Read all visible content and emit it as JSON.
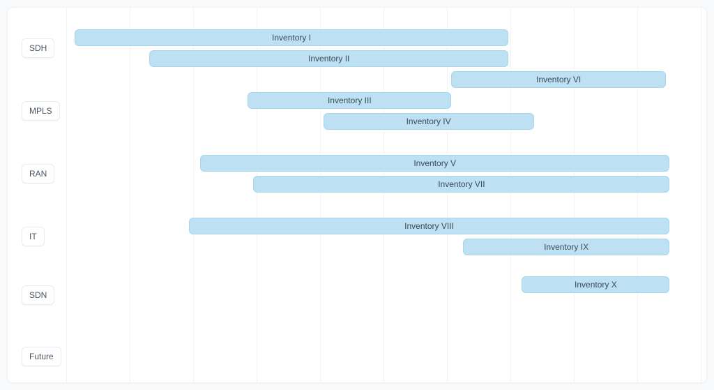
{
  "chart_data": {
    "type": "bar",
    "title": "",
    "xlabel": "",
    "ylabel": "",
    "xlim": [
      0,
      1000
    ],
    "ylim": [
      0,
      6
    ],
    "grid": {
      "x_count": 11
    },
    "categories": [
      "SDH",
      "MPLS",
      "RAN",
      "IT",
      "SDN",
      "Future"
    ],
    "series": [
      {
        "name": "Inventory I",
        "category": "SDH",
        "start": 13,
        "end": 697,
        "sub": 0
      },
      {
        "name": "Inventory II",
        "category": "SDH",
        "start": 131,
        "end": 697,
        "sub": 1
      },
      {
        "name": "Inventory VI",
        "category": "MPLS",
        "start": 607,
        "end": 945,
        "sub": -1
      },
      {
        "name": "Inventory III",
        "category": "MPLS",
        "start": 286,
        "end": 607,
        "sub": 0
      },
      {
        "name": "Inventory IV",
        "category": "MPLS",
        "start": 405,
        "end": 737,
        "sub": 1
      },
      {
        "name": "Inventory V",
        "category": "RAN",
        "start": 211,
        "end": 951,
        "sub": 0
      },
      {
        "name": "Inventory VII",
        "category": "RAN",
        "start": 295,
        "end": 951,
        "sub": 1
      },
      {
        "name": "Inventory VIII",
        "category": "IT",
        "start": 193,
        "end": 951,
        "sub": 0
      },
      {
        "name": "Inventory IX",
        "category": "IT",
        "start": 625,
        "end": 951,
        "sub": 1
      },
      {
        "name": "Inventory X",
        "category": "SDN",
        "start": 718,
        "end": 951,
        "sub": 0
      }
    ]
  },
  "style": {
    "bar_fill": "#bde0f2",
    "bar_stroke": "#a8d6ed",
    "grid_line": "#f1f3f5",
    "label_bg": "#ffffff"
  }
}
